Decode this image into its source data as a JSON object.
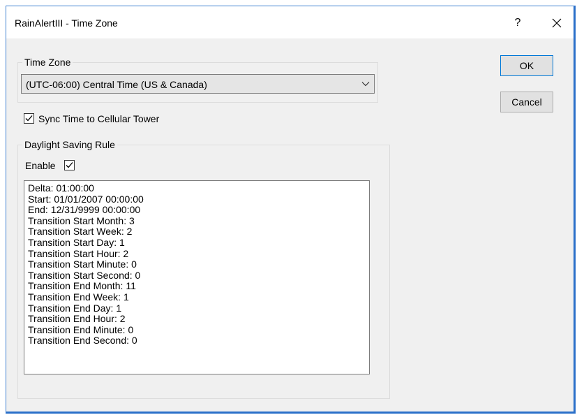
{
  "window": {
    "title": "RainAlertIII - Time Zone",
    "help_label": "?"
  },
  "time_zone_group": {
    "caption": "Time Zone",
    "selected": "(UTC-06:00) Central Time (US & Canada)"
  },
  "sync_checkbox": {
    "label": "Sync Time to Cellular Tower",
    "checked": true
  },
  "dst_group": {
    "caption": "Daylight Saving Rule",
    "enable_label": "Enable",
    "enable_checked": true,
    "rule_lines": [
      "Delta: 01:00:00",
      "Start: 01/01/2007 00:00:00",
      "End: 12/31/9999 00:00:00",
      "Transition Start Month: 3",
      "Transition Start Week: 2",
      "Transition Start Day: 1",
      "Transition Start Hour: 2",
      "Transition Start Minute: 0",
      "Transition Start Second: 0",
      "Transition End Month: 11",
      "Transition End Week: 1",
      "Transition End Day: 1",
      "Transition End Hour: 2",
      "Transition End Minute: 0",
      "Transition End Second: 0"
    ]
  },
  "buttons": {
    "ok": "OK",
    "cancel": "Cancel"
  },
  "colors": {
    "window_border": "#2a6fc9",
    "dialog_bg": "#f0f0f0",
    "default_button_border": "#0078d7"
  },
  "icons": {
    "close": "close-icon",
    "dropdown": "chevron-down-icon",
    "check": "checkmark-icon"
  }
}
